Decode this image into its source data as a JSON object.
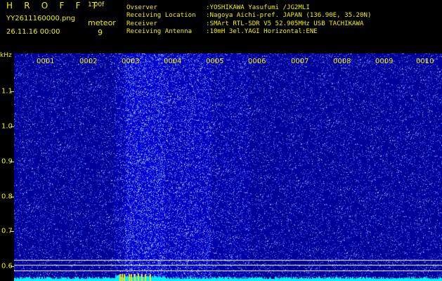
{
  "header": {
    "logo": "H R O F F T",
    "version": "1.00f",
    "filename": "YY2611160000.png",
    "meteor_label": "meteor",
    "timestamp": "26.11.16 00:00",
    "meteor_count": "9",
    "meta": [
      {
        "key": "Ovserver",
        "value": ":YOSHIKAWA Yasufumi /JG2MLI"
      },
      {
        "key": "Receiving Location",
        "value": ":Nagoya Aichi-pref. JAPAN (136.90E, 35.20N)"
      },
      {
        "key": "Receiver",
        "value": ":SMArt RTL-SDR V5 52.905MHz USB TACHIKAWA"
      },
      {
        "key": "Receiving Antenna",
        "value": ":10mH 3el.YAGI Horizontal:ENE"
      }
    ]
  },
  "plot": {
    "y_unit": "kHz",
    "y_ticks": [
      {
        "label": "1.1",
        "value": 1.1
      },
      {
        "label": "1.0",
        "value": 1.0
      },
      {
        "label": "0.9",
        "value": 0.9
      },
      {
        "label": "0.8",
        "value": 0.8
      },
      {
        "label": "0.7",
        "value": 0.7
      },
      {
        "label": "0.6",
        "value": 0.6
      }
    ],
    "x_ticks": [
      "0001",
      "0002",
      "0003",
      "0004",
      "0005",
      "0006",
      "0007",
      "0008",
      "0009",
      "0010"
    ],
    "colors": {
      "label": "#f0f000",
      "background": "#00008a",
      "signal": "#4a6dff",
      "spectrum": "#00f0ff",
      "marker": "#ffe000",
      "guide": "#ffffff"
    }
  }
}
